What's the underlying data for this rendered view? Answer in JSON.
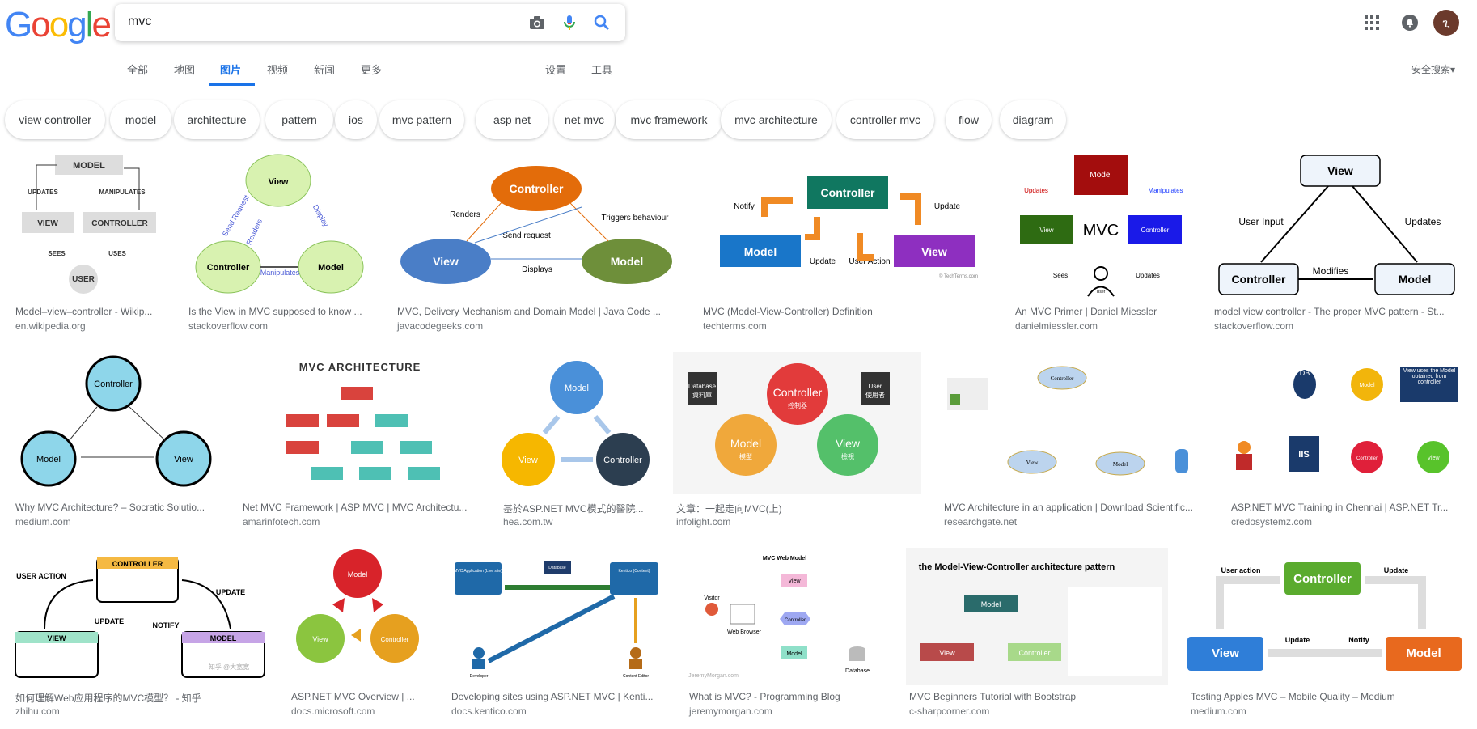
{
  "logo": {
    "letters": [
      "G",
      "o",
      "o",
      "g",
      "l",
      "e"
    ],
    "colors": [
      "#4285f4",
      "#ea4335",
      "#fbbc05",
      "#4285f4",
      "#34a853",
      "#ea4335"
    ]
  },
  "search": {
    "value": "mvc"
  },
  "icons": {
    "camera": "camera-icon",
    "mic": "mic-icon",
    "search": "search-icon",
    "apps": "apps-grid-icon",
    "notifications": "notifications-icon"
  },
  "avatar": {
    "letter": "ጊ"
  },
  "tabs": [
    {
      "label": "全部"
    },
    {
      "label": "地图"
    },
    {
      "label": "图片"
    },
    {
      "label": "视频"
    },
    {
      "label": "新闻"
    },
    {
      "label": "更多"
    },
    {
      "label": "设置"
    },
    {
      "label": "工具"
    }
  ],
  "active_tab": "图片",
  "safe_search": "安全搜索▾",
  "chips": [
    "view controller",
    "model",
    "architecture",
    "pattern",
    "ios",
    "mvc pattern",
    "asp net",
    "net mvc",
    "mvc framework",
    "mvc architecture",
    "controller mvc",
    "flow",
    "diagram"
  ],
  "results": [
    {
      "title": "Model–view–controller - Wikip...",
      "source": "en.wikipedia.org",
      "labels": [
        "MODEL",
        "UPDATES",
        "MANIPULATES",
        "VIEW",
        "CONTROLLER",
        "SEES",
        "USES",
        "USER"
      ]
    },
    {
      "title": "Is the View in MVC supposed to know ...",
      "source": "stackoverflow.com",
      "labels": [
        "View",
        "Send Request",
        "Display",
        "Renders",
        "Controller",
        "Model",
        "Manipulates"
      ]
    },
    {
      "title": "MVC, Delivery Mechanism and Domain Model | Java Code ...",
      "source": "javacodegeeks.com",
      "labels": [
        "Controller",
        "Renders",
        "Triggers behaviour",
        "Send request",
        "View",
        "Displays",
        "Model"
      ]
    },
    {
      "title": "MVC (Model-View-Controller) Definition",
      "source": "techterms.com",
      "labels": [
        "Notify",
        "Controller",
        "Update",
        "Model",
        "Update",
        "User Action",
        "View",
        "© TechTerms.com"
      ]
    },
    {
      "title": "An MVC Primer | Daniel Miessler",
      "source": "danielmiessler.com",
      "labels": [
        "Model",
        "Updates",
        "Manipulates",
        "View",
        "MVC",
        "Controller",
        "Sees",
        "Updates",
        "User"
      ]
    },
    {
      "title": "model view controller - The proper MVC pattern - St...",
      "source": "stackoverflow.com",
      "labels": [
        "View",
        "User Input",
        "Updates",
        "Controller",
        "Modifies",
        "Model"
      ]
    },
    {
      "title": "Why MVC Architecture? – Socratic Solutio...",
      "source": "medium.com",
      "labels": [
        "Controller",
        "Model",
        "View"
      ]
    },
    {
      "title": "Net MVC Framework | ASP MVC | MVC Architectu...",
      "source": "amarinfotech.com",
      "labels": [
        "MVC ARCHITECTURE"
      ]
    },
    {
      "title": "基於ASP.NET MVC模式的醫院...",
      "source": "hea.com.tw",
      "labels": [
        "Model",
        "View",
        "Controller"
      ]
    },
    {
      "title": "文章：一起走向MVC(上)",
      "source": "infolight.com",
      "labels": [
        "Database",
        "資料庫",
        "Controller",
        "控制器",
        "User",
        "使用者",
        "Model",
        "模型",
        "View",
        "檢視"
      ]
    },
    {
      "title": "MVC Architecture in an application | Download Scientific...",
      "source": "researchgate.net",
      "labels": [
        "Controller",
        "View",
        "Model"
      ]
    },
    {
      "title": "ASP.NET MVC Training in Chennai | ASP.NET Tr...",
      "source": "credosystemz.com",
      "labels": [
        "DB",
        "Model",
        "View uses the Model obtained from controller",
        "IIS",
        "Controller",
        "View"
      ]
    },
    {
      "title": "如何理解Web应用程序的MVC模型？ - 知乎",
      "source": "zhihu.com",
      "labels": [
        "CONTROLLER",
        "USER ACTION",
        "UPDATE",
        "UPDATE",
        "NOTIFY",
        "VIEW",
        "MODEL",
        "知乎 @大宽宽"
      ]
    },
    {
      "title": "ASP.NET MVC Overview | ...",
      "source": "docs.microsoft.com",
      "labels": [
        "Model",
        "View",
        "Controller"
      ]
    },
    {
      "title": "Developing sites using ASP.NET MVC | Kenti...",
      "source": "docs.kentico.com",
      "labels": [
        "MVC Application (Live site)",
        "Database",
        "Kentico (Content)",
        "Developer",
        "Content Editor"
      ]
    },
    {
      "title": "What is MVC? - Programming Blog",
      "source": "jeremymorgan.com",
      "labels": [
        "MVC Web Model",
        "Visitor",
        "Web Browser",
        "View",
        "Controller",
        "Model",
        "Database",
        "JeremyMorgan.com"
      ]
    },
    {
      "title": "MVC Beginners Tutorial with Bootstrap",
      "source": "c-sharpcorner.com",
      "labels": [
        "the Model-View-Controller architecture pattern",
        "Model",
        "View",
        "Controller"
      ]
    },
    {
      "title": "Testing Apples MVC – Mobile Quality – Medium",
      "source": "medium.com",
      "labels": [
        "User action",
        "Controller",
        "Update",
        "View",
        "Update",
        "Notify",
        "Model"
      ]
    }
  ]
}
